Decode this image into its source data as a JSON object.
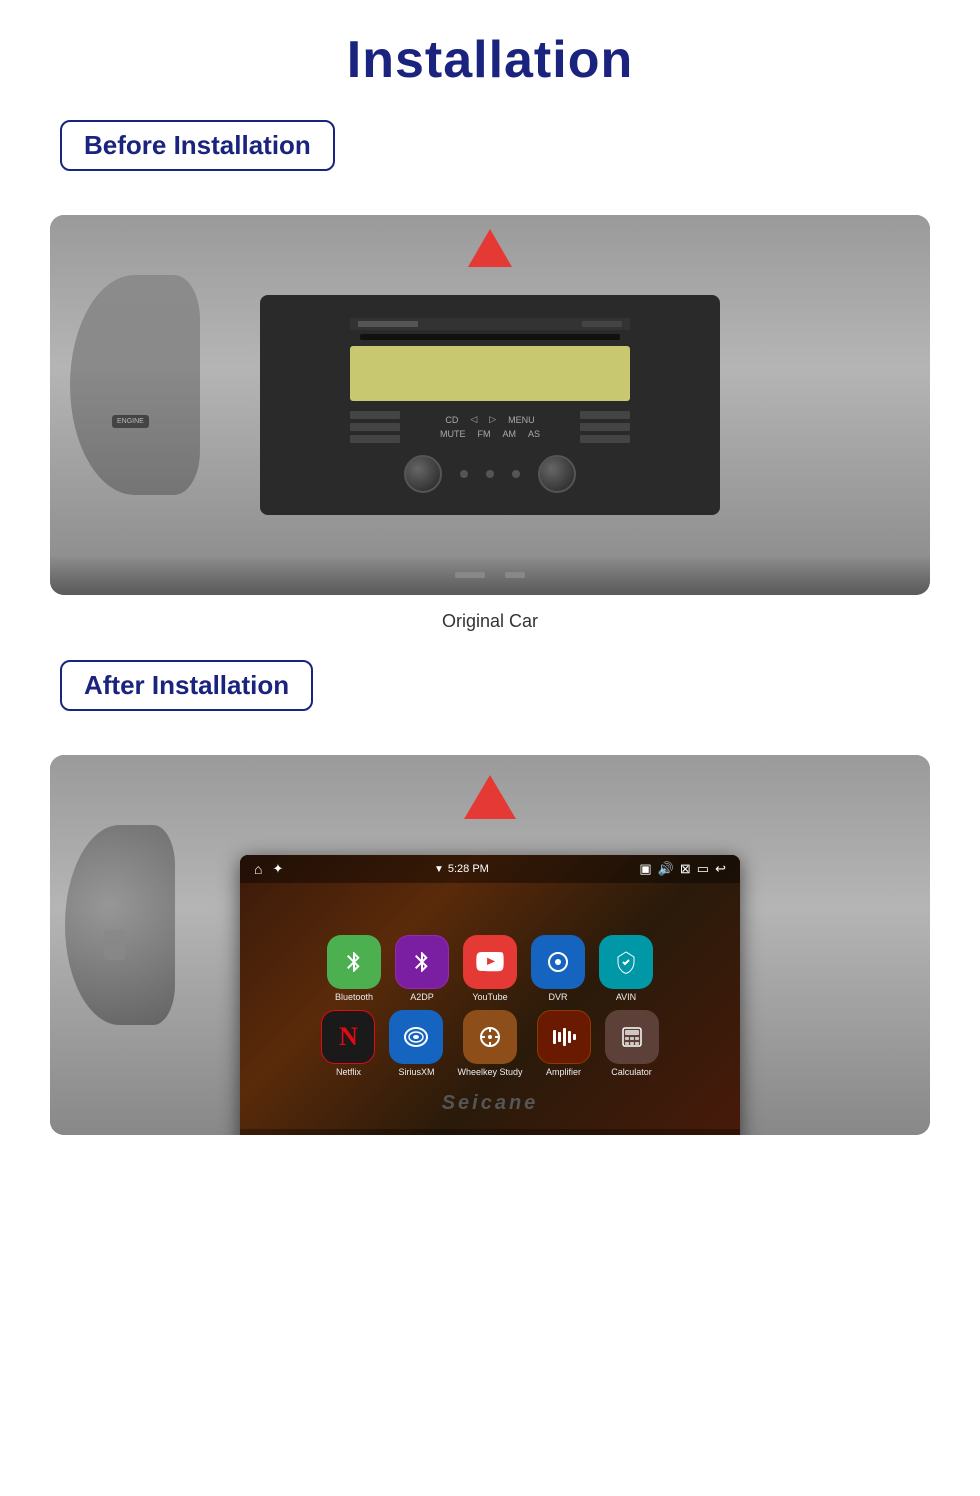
{
  "page": {
    "title": "Installation"
  },
  "before": {
    "badge": "Before Installation",
    "caption": "Original Car"
  },
  "after": {
    "badge": "After Installation"
  },
  "screen": {
    "time": "5:28 PM",
    "apps_row1": [
      {
        "id": "bluetooth",
        "label": "Bluetooth",
        "icon": "⚡"
      },
      {
        "id": "a2dp",
        "label": "A2DP",
        "icon": "⚡"
      },
      {
        "id": "youtube",
        "label": "YouTube",
        "icon": "▶"
      },
      {
        "id": "dvr",
        "label": "DVR",
        "icon": "◎"
      },
      {
        "id": "avin",
        "label": "AVIN",
        "icon": "↕"
      }
    ],
    "apps_row2": [
      {
        "id": "netflix",
        "label": "Netflix",
        "icon": "N"
      },
      {
        "id": "siriusxm",
        "label": "SiriusXM",
        "icon": "≋"
      },
      {
        "id": "wheelkey",
        "label": "Wheelkey Study",
        "icon": "⊕"
      },
      {
        "id": "amplifier",
        "label": "Amplifier",
        "icon": "⊞"
      },
      {
        "id": "calculator",
        "label": "Calculator",
        "icon": "▦"
      }
    ]
  },
  "brand": "Seicane"
}
